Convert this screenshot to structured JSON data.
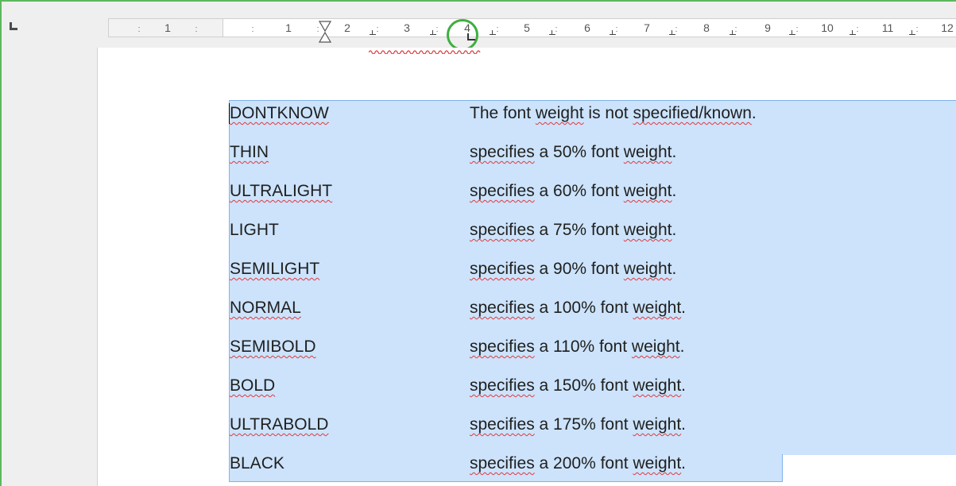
{
  "ruler": {
    "numbers": [
      "1",
      "1",
      "2",
      "3",
      "4",
      "5",
      "6",
      "7",
      "8",
      "9",
      "10",
      "11",
      "12"
    ]
  },
  "document": {
    "rows": [
      {
        "key": "DONTKNOW",
        "desc_parts": [
          "The font ",
          "weight",
          " is not ",
          "specified/known",
          "."
        ]
      },
      {
        "key": "THIN",
        "desc_parts": [
          "specifies",
          " a 50% font ",
          "weight",
          "."
        ]
      },
      {
        "key": "ULTRALIGHT",
        "desc_parts": [
          "specifies",
          " a 60% font ",
          "weight",
          "."
        ]
      },
      {
        "key": "LIGHT",
        "desc_parts": [
          "specifies",
          " a 75% font ",
          "weight",
          "."
        ]
      },
      {
        "key": "SEMILIGHT",
        "desc_parts": [
          "specifies",
          " a 90% font ",
          "weight",
          "."
        ]
      },
      {
        "key": "NORMAL",
        "desc_parts": [
          "specifies",
          " a 100% font ",
          "weight",
          "."
        ]
      },
      {
        "key": "SEMIBOLD",
        "desc_parts": [
          "specifies",
          " a 110% font ",
          "weight",
          "."
        ]
      },
      {
        "key": "BOLD",
        "desc_parts": [
          "specifies",
          " a 150% font ",
          "weight",
          "."
        ]
      },
      {
        "key": "ULTRABOLD",
        "desc_parts": [
          "specifies",
          " a 175% font ",
          "weight",
          "."
        ]
      },
      {
        "key": "BLACK",
        "desc_parts": [
          "specifies",
          " a 200% font ",
          "weight",
          "."
        ]
      }
    ]
  },
  "colors": {
    "selection": "#cce3fb",
    "spellcheck": "#e0393e",
    "highlight_circle": "#3fae3f"
  },
  "icons": {
    "tab_type": "left-tab-icon",
    "indent": "hourglass-indent-icon"
  }
}
